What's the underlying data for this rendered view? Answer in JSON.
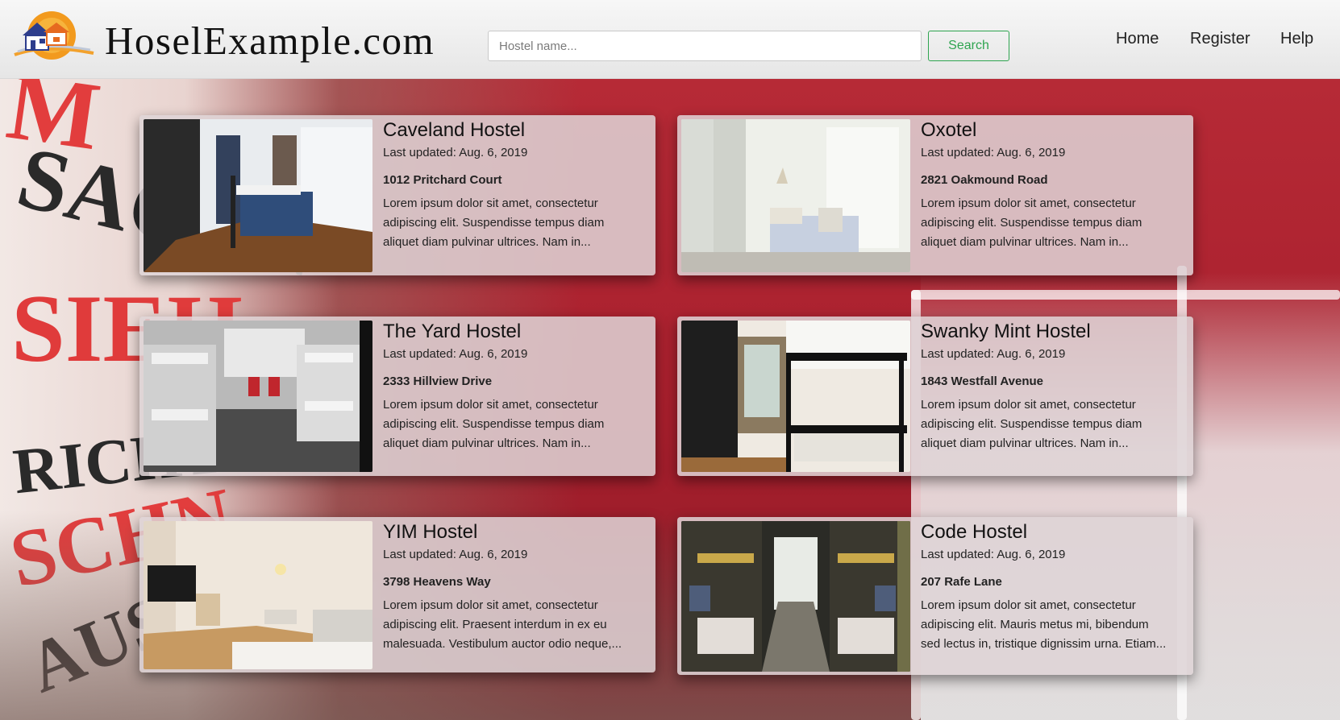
{
  "header": {
    "site_title": "HoselExample.com",
    "search_placeholder": "Hostel name...",
    "search_label": "Search",
    "nav": [
      "Home",
      "Register",
      "Help"
    ]
  },
  "colors": {
    "accent_green": "#2ea44f",
    "card_bg": "#ded4d6",
    "background_red": "#a81f2d"
  },
  "hostels": [
    {
      "name": "Caveland Hostel",
      "updated": "Last updated: Aug. 6, 2019",
      "address": "1012 Pritchard Court",
      "desc": [
        "Lorem ipsum dolor sit amet, consectetur",
        "adipiscing elit. Suspendisse tempus diam",
        "aliquet diam pulvinar ultrices. Nam in..."
      ]
    },
    {
      "name": "Oxotel",
      "updated": "Last updated: Aug. 6, 2019",
      "address": "2821 Oakmound Road",
      "desc": [
        "Lorem ipsum dolor sit amet, consectetur",
        "adipiscing elit. Suspendisse tempus diam",
        "aliquet diam pulvinar ultrices. Nam in..."
      ]
    },
    {
      "name": "The Yard Hostel",
      "updated": "Last updated: Aug. 6, 2019",
      "address": "2333 Hillview Drive",
      "desc": [
        "Lorem ipsum dolor sit amet, consectetur",
        "adipiscing elit. Suspendisse tempus diam",
        "aliquet diam pulvinar ultrices. Nam in..."
      ]
    },
    {
      "name": "Swanky Mint Hostel",
      "updated": "Last updated: Aug. 6, 2019",
      "address": "1843 Westfall Avenue",
      "desc": [
        "Lorem ipsum dolor sit amet, consectetur",
        "adipiscing elit. Suspendisse tempus diam",
        "aliquet diam pulvinar ultrices. Nam in..."
      ]
    },
    {
      "name": "YIM Hostel",
      "updated": "Last updated: Aug. 6, 2019",
      "address": "3798 Heavens Way",
      "desc": [
        "Lorem ipsum dolor sit amet, consectetur",
        "adipiscing elit. Praesent interdum in ex eu",
        "malesuada. Vestibulum auctor odio neque,..."
      ]
    },
    {
      "name": "Code Hostel",
      "updated": "Last updated: Aug. 6, 2019",
      "address": "207 Rafe Lane",
      "desc": [
        "Lorem ipsum dolor sit amet, consectetur",
        "adipiscing elit. Mauris metus mi, bibendum",
        "sed lectus in, tristique dignissim urna. Etiam..."
      ]
    }
  ]
}
